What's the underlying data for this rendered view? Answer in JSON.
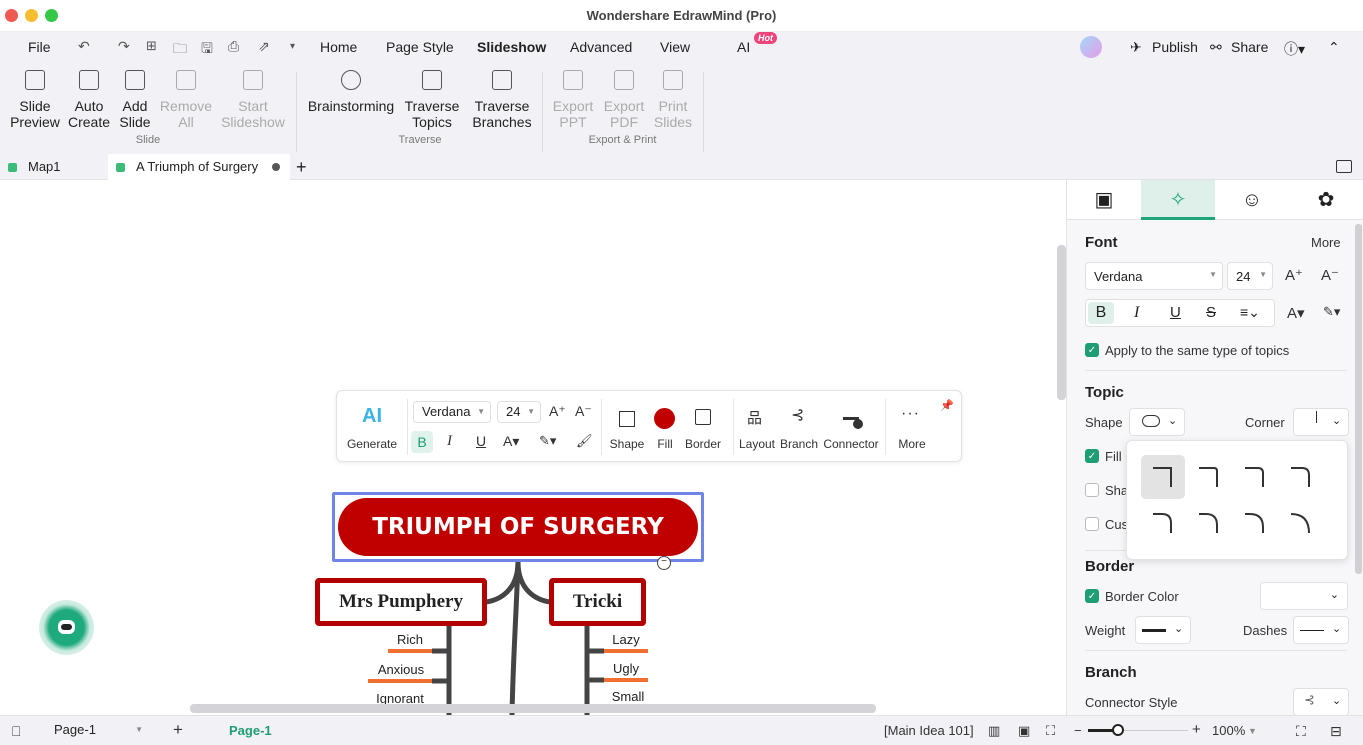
{
  "window": {
    "title": "Wondershare EdrawMind (Pro)"
  },
  "menu": {
    "file": "File",
    "items": [
      "Home",
      "Page Style",
      "Slideshow",
      "Advanced",
      "View",
      "AI"
    ],
    "active": "Slideshow",
    "ai_badge": "Hot",
    "publish": "Publish",
    "share": "Share"
  },
  "ribbon": {
    "buttons": [
      {
        "label1": "Slide",
        "label2": "Preview",
        "enabled": true
      },
      {
        "label1": "Auto",
        "label2": "Create",
        "enabled": true
      },
      {
        "label1": "Add",
        "label2": "Slide",
        "enabled": true
      },
      {
        "label1": "Remove",
        "label2": "All",
        "enabled": false
      },
      {
        "label1": "Start",
        "label2": "Slideshow",
        "enabled": false
      },
      {
        "label1": "Brainstorming",
        "label2": "",
        "enabled": true
      },
      {
        "label1": "Traverse",
        "label2": "Topics",
        "enabled": true
      },
      {
        "label1": "Traverse",
        "label2": "Branches",
        "enabled": true
      },
      {
        "label1": "Export",
        "label2": "PPT",
        "enabled": false
      },
      {
        "label1": "Export",
        "label2": "PDF",
        "enabled": false
      },
      {
        "label1": "Print",
        "label2": "Slides",
        "enabled": false
      }
    ],
    "groups": {
      "slide": "Slide",
      "traverse": "Traverse",
      "export": "Export & Print"
    }
  },
  "doc_tabs": [
    {
      "label": "Map1",
      "active": false
    },
    {
      "label": "A Triumph of Surgery",
      "active": true,
      "unsaved": true
    }
  ],
  "floating_toolbar": {
    "generate": "Generate",
    "font": "Verdana",
    "size": "24",
    "shape": "Shape",
    "fill": "Fill",
    "border": "Border",
    "layout": "Layout",
    "branch": "Branch",
    "connector": "Connector",
    "more": "More",
    "fill_color": "#c00000"
  },
  "mindmap": {
    "root": "TRIUMPH OF SURGERY",
    "topics": [
      {
        "label": "Mrs Pumphery",
        "subtopics": [
          "Rich",
          "Anxious",
          "Ignorant"
        ]
      },
      {
        "label": "Tricki",
        "subtopics": [
          "Lazy",
          "Ugly",
          "Small"
        ]
      }
    ],
    "colors": {
      "root": "#c00000",
      "border": "#b30000",
      "accent": "#f07030",
      "branch": "#444444"
    }
  },
  "panel": {
    "font_section": "Font",
    "more": "More",
    "font": "Verdana",
    "size": "24",
    "apply_same": "Apply to the same type of topics",
    "topic_section": "Topic",
    "shape_label": "Shape",
    "corner_label": "Corner",
    "fill_label": "Fill Color",
    "shadow_label": "Shadow",
    "custom_label": "Custom",
    "border_section": "Border",
    "border_color": "Border Color",
    "weight": "Weight",
    "dashes": "Dashes",
    "branch_section": "Branch",
    "connector_style": "Connector Style"
  },
  "status": {
    "page_select": "Page-1",
    "page_tab": "Page-1",
    "main_idea": "[Main Idea 101]",
    "zoom": "100%",
    "zoom_level": 0.3
  }
}
